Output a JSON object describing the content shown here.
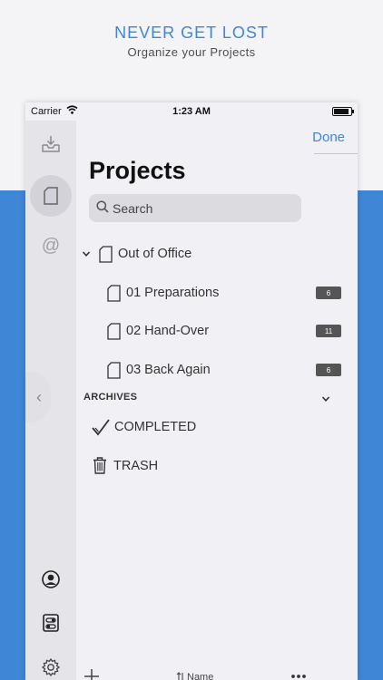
{
  "promo": {
    "headline": "NEVER GET LOST",
    "subline": "Organize your Projects",
    "accent_color": "#3f86d6"
  },
  "status_bar": {
    "carrier": "Carrier",
    "time": "1:23 AM",
    "battery_level": 0.9
  },
  "nav": {
    "done_label": "Done"
  },
  "page": {
    "title": "Projects"
  },
  "search": {
    "placeholder": "Search"
  },
  "rail": {
    "icons": [
      "inbox-icon",
      "project-icon",
      "at-icon",
      "user-icon",
      "toggles-icon",
      "gear-icon"
    ],
    "collapse_icon": "chevron-left-icon"
  },
  "tree": {
    "group": {
      "label": "Out of Office",
      "expanded": true
    },
    "items": [
      {
        "label": "01 Preparations",
        "count": "6"
      },
      {
        "label": "02 Hand-Over",
        "count": "11"
      },
      {
        "label": "03 Back Again",
        "count": "6"
      }
    ]
  },
  "archives": {
    "header": "ARCHIVES",
    "completed": "COMPLETED",
    "trash": "TRASH"
  },
  "toolbar": {
    "sort_label": "Name",
    "add_icon": "plus-icon",
    "sort_icon": "sort-icon",
    "more_icon": "more-icon"
  }
}
